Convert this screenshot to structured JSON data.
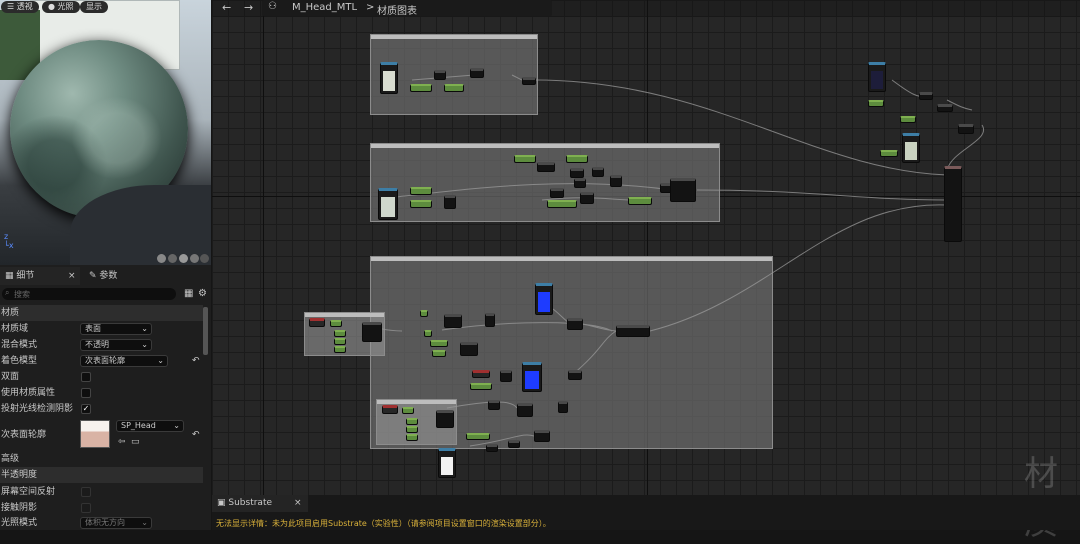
{
  "viewport": {
    "buttons": [
      "透视",
      "光照",
      "显示"
    ]
  },
  "graph_header": {
    "asset_name": "M_Head_MTL",
    "breadcrumb_sep": ">",
    "tab_label": "材质图表"
  },
  "details": {
    "tab_details": "细节",
    "tab_close": "×",
    "tab_params": "参数",
    "search_placeholder": "搜索",
    "section_material": "材质",
    "rows": [
      {
        "label": "材质域",
        "value": "表面"
      },
      {
        "label": "混合模式",
        "value": "不透明"
      },
      {
        "label": "着色模型",
        "value": "次表面轮廓"
      },
      {
        "label": "双面"
      },
      {
        "label": "使用材质属性"
      },
      {
        "label": "投射光线检测阴影"
      },
      {
        "label": "次表面轮廓",
        "value": "SP_Head"
      }
    ],
    "section_advanced": "高级",
    "section_translucency": "半透明度",
    "rows2": [
      {
        "label": "屏幕空间反射"
      },
      {
        "label": "接触阴影"
      },
      {
        "label": "光照模式",
        "value": "体积无方向"
      }
    ]
  },
  "bottom": {
    "tab_label": "Substrate",
    "tab_close": "×",
    "message": "无法显示详情：未为此项目启用Substrate（实验性）（请参阅项目设置窗口的渲染设置部分）。"
  },
  "watermark": "材质",
  "colors": {
    "accent_yellow": "#d9b13a",
    "node_green": "#5d8c3e",
    "texture_blue": "#1e3cff",
    "checkbox_checked": "#1a73e8"
  }
}
